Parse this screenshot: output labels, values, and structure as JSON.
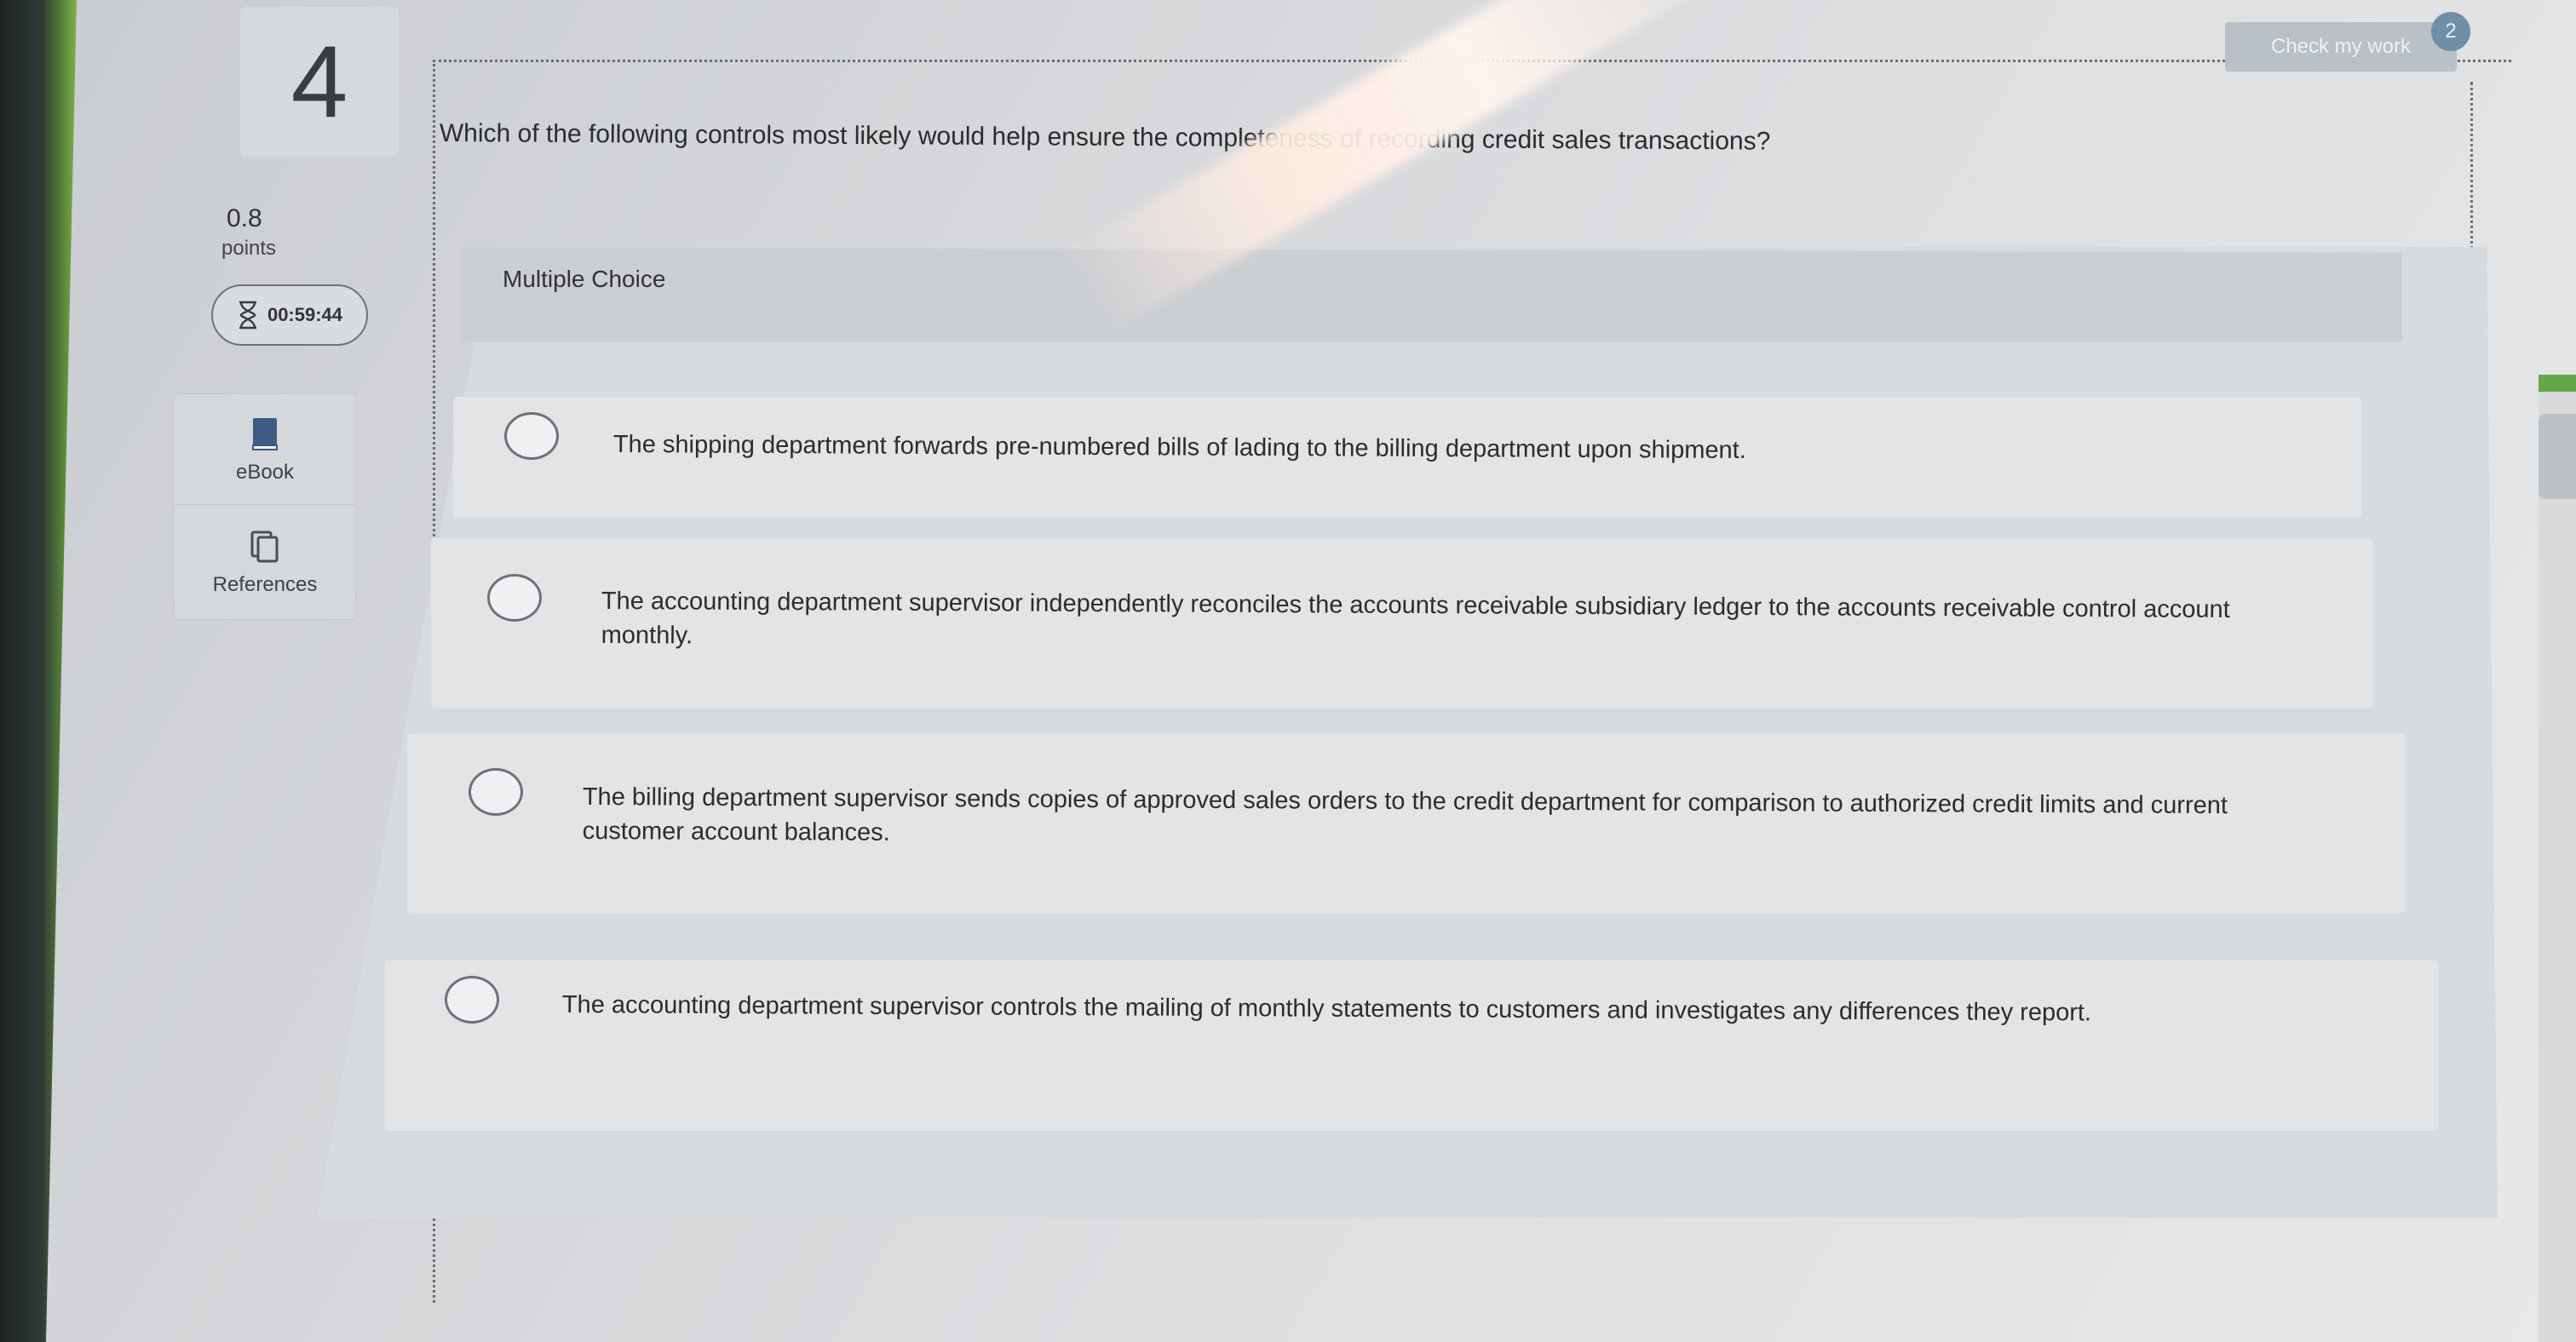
{
  "question": {
    "number": "4",
    "points_value": "0.8",
    "points_label": "points",
    "timer": "00:59:44",
    "text": "Which of the following controls most likely would help ensure the completeness of recording credit sales transactions?"
  },
  "tools": {
    "ebook_label": "eBook",
    "references_label": "References"
  },
  "header": {
    "check_my_work_label": "Check my work",
    "check_badge": "2"
  },
  "answer": {
    "type_label": "Multiple Choice",
    "options": [
      {
        "text": "The shipping department forwards pre-numbered bills of lading to the billing department upon shipment."
      },
      {
        "text": "The accounting department supervisor independently reconciles the accounts receivable subsidiary ledger to the accounts receivable control account monthly."
      },
      {
        "text": "The billing department supervisor sends copies of approved sales orders to the credit department for comparison to authorized credit limits and current customer account balances."
      },
      {
        "text": "The accounting department supervisor controls the mailing of monthly statements to customers and investigates any differences they report."
      }
    ]
  },
  "colors": {
    "accent_green": "#66a64a",
    "button_gray": "#b9c0c6",
    "badge_blue": "#6f8fa6"
  }
}
